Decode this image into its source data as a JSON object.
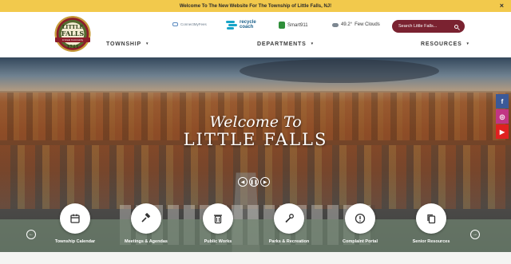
{
  "announcement": {
    "text": "Welcome To The New Website For The Township of Little Falls, NJ!",
    "close": "×"
  },
  "logo": {
    "line1": "LITTLE",
    "line2": "FALLS",
    "banner": "A Great Community",
    "year": "1711"
  },
  "partners": {
    "connect": "ConnectMyFees",
    "recycle_line1": "recycle",
    "recycle_line2": "coach",
    "smart": "Smart911"
  },
  "weather": {
    "temp": "49.2°",
    "condition": "Few Clouds"
  },
  "search": {
    "placeholder": "Search Little Falls..."
  },
  "nav": [
    {
      "label": "TOWNSHIP"
    },
    {
      "label": "DEPARTMENTS"
    },
    {
      "label": "RESOURCES"
    }
  ],
  "hero": {
    "welcome_script": "Welcome To",
    "welcome_title": "LITTLE FALLS"
  },
  "social": {
    "facebook": "f",
    "instagram": "◎",
    "youtube": "▶"
  },
  "quick_links": [
    {
      "label": "Township Calendar",
      "icon": "calendar-icon"
    },
    {
      "label": "Meetings & Agendas",
      "icon": "gavel-icon"
    },
    {
      "label": "Public Works",
      "icon": "trash-icon"
    },
    {
      "label": "Parks & Recreation",
      "icon": "wrench-icon"
    },
    {
      "label": "Complaint Portal",
      "icon": "alert-icon"
    },
    {
      "label": "Senior Resources",
      "icon": "copy-icon"
    }
  ],
  "colors": {
    "announcement_bg": "#f2c94c",
    "search_bg": "#7a2230",
    "quickbar": "#708470"
  }
}
